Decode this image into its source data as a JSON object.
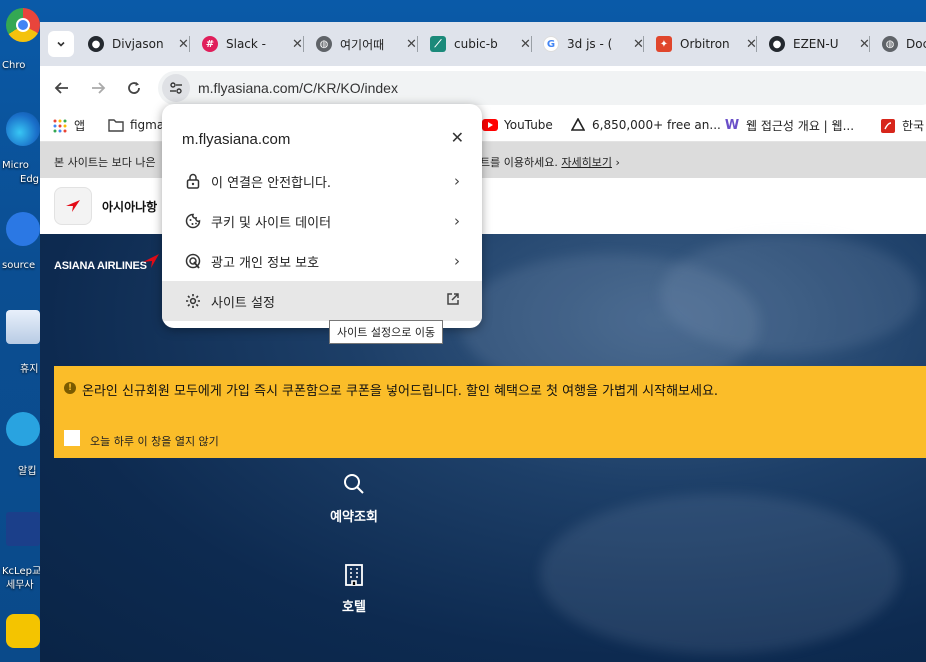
{
  "desktop": {
    "icons": [
      {
        "label": "Chro",
        "color": "#e8453c"
      },
      {
        "label": "Micro",
        "label2": "Edg",
        "color": "#1a8ad4"
      },
      {
        "label": "source",
        "color": "#2b78e4"
      },
      {
        "label": "휴지",
        "color": "#dfe9f5"
      },
      {
        "label": "알킵",
        "color": "#29a3e0"
      },
      {
        "label": "KcLep교",
        "label2": "세무사",
        "color": "#1b3f8a"
      },
      {
        "label": "",
        "color": "#f4c400"
      }
    ]
  },
  "tabs": [
    {
      "label": "Divjason",
      "icon": "github-icon",
      "color": "#24292f"
    },
    {
      "label": "Slack -",
      "icon": "slack-icon",
      "color": "#e01e5a"
    },
    {
      "label": "여기어때",
      "icon": "globe-icon",
      "color": "#5f6368"
    },
    {
      "label": "cubic-b",
      "icon": "cubic-bezier-icon",
      "color": "#1b8a7a"
    },
    {
      "label": "3d js - (",
      "icon": "google-icon",
      "color": "#4285f4"
    },
    {
      "label": "Orbitron",
      "icon": "orbitron-icon",
      "color": "#e0462c"
    },
    {
      "label": "EZEN-U",
      "icon": "github-icon",
      "color": "#24292f"
    },
    {
      "label": "Doc",
      "icon": "globe-icon",
      "color": "#5f6368"
    }
  ],
  "toolbar": {
    "url": "m.flyasiana.com/C/KR/KO/index"
  },
  "bookmarks": [
    {
      "label": "앱",
      "icon": "apps-grid-icon"
    },
    {
      "label": "figma",
      "icon": "folder-icon"
    },
    {
      "label": "YouTube",
      "icon": "youtube-icon"
    },
    {
      "label": "6,850,000+ free an...",
      "icon": "freepik-icon"
    },
    {
      "label": "웹 접근성 개요 | 웹...",
      "icon": "w-icon"
    },
    {
      "label": "한국",
      "icon": "pdf-icon"
    }
  ],
  "page": {
    "notice_left": "본 사이트는 보다 나은",
    "notice_right": "트를 이용하세요.",
    "notice_link": "자세히보기",
    "app_name": "아시아나항",
    "airline_logo": "ASIANA AIRLINES",
    "banner_text": "온라인 신규회원 모두에게 가입 즉시 쿠폰함으로 쿠폰을 넣어드립니다. 할인 혜택으로 첫 여행을 가볍게 시작해보세요.",
    "banner_check_label": "오늘 하루 이 창을 열지 않기",
    "quick_links": [
      "예약조회",
      "호텔"
    ]
  },
  "popup": {
    "title": "m.flyasiana.com",
    "items": [
      {
        "label": "이 연결은 안전합니다.",
        "icon": "lock-icon"
      },
      {
        "label": "쿠키 및 사이트 데이터",
        "icon": "cookie-icon"
      },
      {
        "label": "광고 개인 정보 보호",
        "icon": "ad-privacy-icon"
      },
      {
        "label": "사이트 설정",
        "icon": "settings-gear-icon"
      }
    ],
    "tooltip": "사이트 설정으로 이동"
  },
  "colors": {
    "accent_yellow": "#fbbd29",
    "asiana_red": "#e30b17",
    "page_navy": "#0c2a52"
  }
}
